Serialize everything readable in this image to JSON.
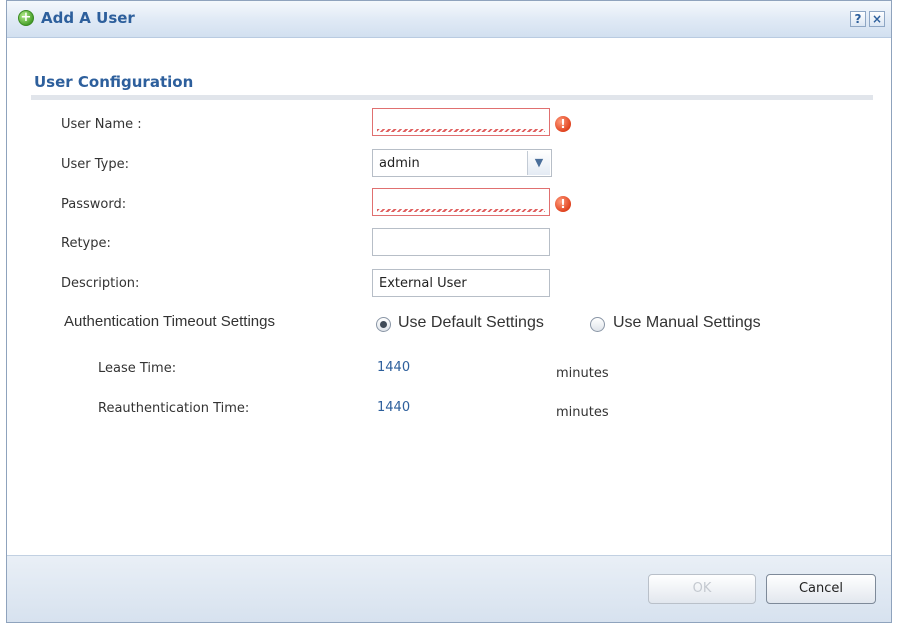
{
  "dialog": {
    "title": "Add A User",
    "help_label": "?",
    "close_label": "×"
  },
  "section": {
    "title": "User Configuration"
  },
  "fields": {
    "user_name": {
      "label": "User Name :",
      "value": "",
      "error_icon": "!"
    },
    "user_type": {
      "label": "User Type:",
      "value": "admin"
    },
    "password": {
      "label": "Password:",
      "value": "",
      "error_icon": "!"
    },
    "retype": {
      "label": "Retype:",
      "value": ""
    },
    "description": {
      "label": "Description:",
      "value": "External User"
    }
  },
  "auth_timeout": {
    "label": "Authentication Timeout Settings",
    "options": [
      {
        "label": "Use Default Settings",
        "checked": true
      },
      {
        "label": "Use Manual Settings",
        "checked": false
      }
    ],
    "lease_time": {
      "label": "Lease Time:",
      "value": "1440",
      "unit": "minutes"
    },
    "reauth_time": {
      "label": "Reauthentication Time:",
      "value": "1440",
      "unit": "minutes"
    }
  },
  "buttons": {
    "ok": "OK",
    "cancel": "Cancel"
  },
  "icons": {
    "title": "add-user-icon",
    "error": "error-icon",
    "dropdown": "chevron-down-icon"
  },
  "colors": {
    "accent": "#2d5f9c",
    "error": "#e0431f"
  }
}
